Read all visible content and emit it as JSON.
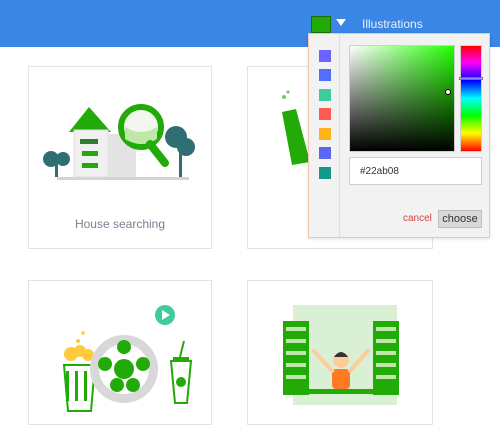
{
  "header": {
    "section_title": "Illustrations",
    "selected_color": "#22ab08"
  },
  "cards": [
    {
      "label": "House searching"
    },
    {
      "label": ""
    },
    {
      "label": ""
    },
    {
      "label": ""
    }
  ],
  "color_picker": {
    "hex_value": "#22ab08",
    "cancel_label": "cancel",
    "choose_label": "choose",
    "swatches": [
      "#6c63ff",
      "#536dfe",
      "#3ecb9d",
      "#ff5b54",
      "#ffb31a",
      "#5a67f2",
      "#12998a"
    ]
  }
}
